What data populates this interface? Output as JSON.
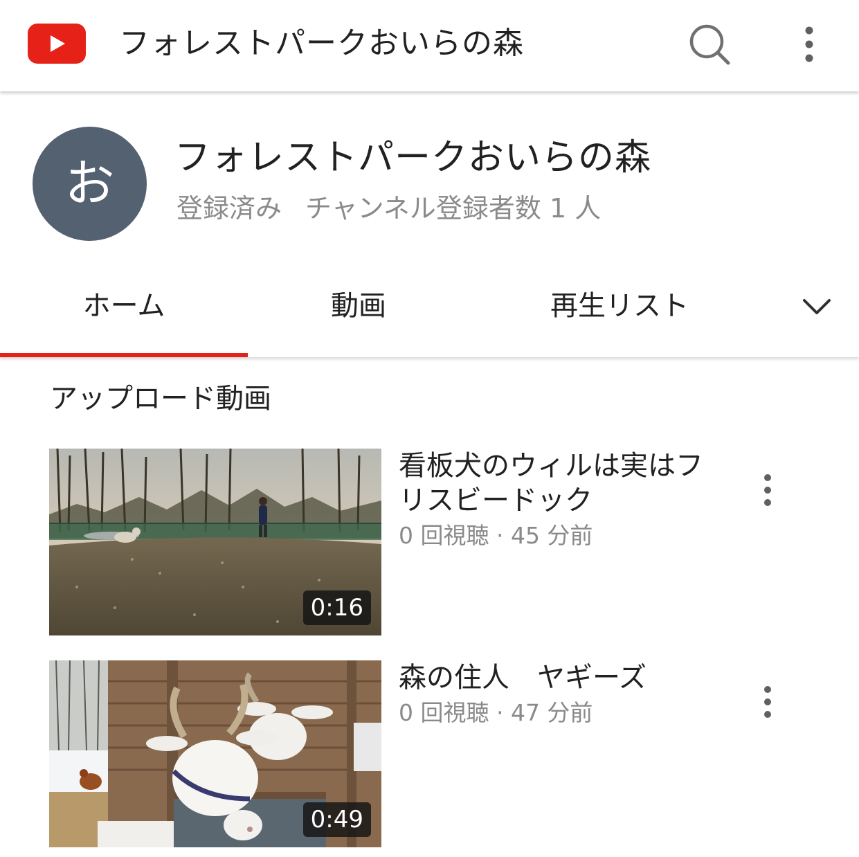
{
  "app": {
    "title": "フォレストパークおいらの森"
  },
  "channel": {
    "avatar_letter": "お",
    "name": "フォレストパークおいらの森",
    "subscribed_label": "登録済み",
    "subscribers": "チャンネル登録者数 1 人"
  },
  "tabs": [
    {
      "label": "ホーム",
      "selected": true
    },
    {
      "label": "動画",
      "selected": false
    },
    {
      "label": "再生リスト",
      "selected": false
    }
  ],
  "section": {
    "title": "アップロード動画"
  },
  "videos": [
    {
      "title": "看板犬のウィルは実はフリスビードック",
      "meta": "0 回視聴 · 45 分前",
      "duration": "0:16"
    },
    {
      "title": "森の住人　ヤギーズ",
      "meta": "0 回視聴 · 47 分前",
      "duration": "0:49"
    }
  ],
  "colors": {
    "accent": "#e62117",
    "avatar": "#546170",
    "secondary_text": "#8a8a8a"
  },
  "icons": [
    "youtube-logo-icon",
    "search-icon",
    "more-vert-icon",
    "chevron-down-icon"
  ]
}
